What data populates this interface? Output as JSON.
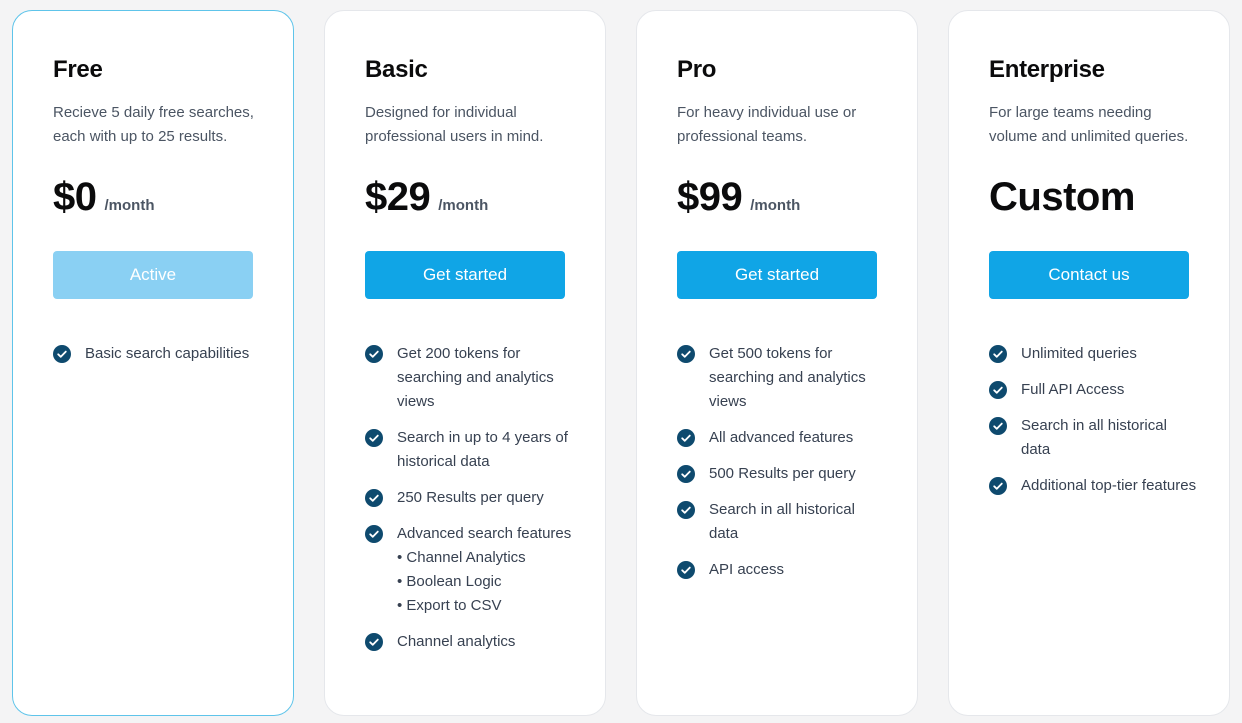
{
  "plans": [
    {
      "name": "Free",
      "description": "Recieve 5 daily free searches, each with up to 25 results.",
      "price": "$0",
      "period": "/month",
      "button_label": "Active",
      "button_state": "disabled",
      "active": true,
      "features": [
        {
          "text": "Basic search capabilities"
        }
      ]
    },
    {
      "name": "Basic",
      "description": "Designed for individual professional users in mind.",
      "price": "$29",
      "period": "/month",
      "button_label": "Get started",
      "button_state": "enabled",
      "active": false,
      "features": [
        {
          "text": "Get 200 tokens for searching and analytics views"
        },
        {
          "text": "Search in up to 4 years of historical data"
        },
        {
          "text": "250 Results per query"
        },
        {
          "text": "Advanced search features",
          "sub": [
            "• Channel Analytics",
            "• Boolean Logic",
            "• Export to CSV"
          ]
        },
        {
          "text": "Channel analytics"
        }
      ]
    },
    {
      "name": "Pro",
      "description": "For heavy individual use or professional teams.",
      "price": "$99",
      "period": "/month",
      "button_label": "Get started",
      "button_state": "enabled",
      "active": false,
      "features": [
        {
          "text": "Get 500 tokens for searching and analytics views"
        },
        {
          "text": "All advanced features"
        },
        {
          "text": "500 Results per query"
        },
        {
          "text": "Search in all historical data"
        },
        {
          "text": "API access"
        }
      ]
    },
    {
      "name": "Enterprise",
      "description": "For large teams needing volume and unlimited queries.",
      "price": "Custom",
      "period": "",
      "button_label": "Contact us",
      "button_state": "enabled",
      "active": false,
      "features": [
        {
          "text": "Unlimited queries"
        },
        {
          "text": "Full API Access"
        },
        {
          "text": "Search in all historical data"
        },
        {
          "text": "Additional top-tier features"
        }
      ]
    }
  ],
  "colors": {
    "accent": "#10a5e6",
    "accent_disabled": "#8ad0f3",
    "check": "#0e4a6e",
    "active_border": "#5ec4ea"
  },
  "icons": {
    "feature": "check-circle-icon"
  }
}
